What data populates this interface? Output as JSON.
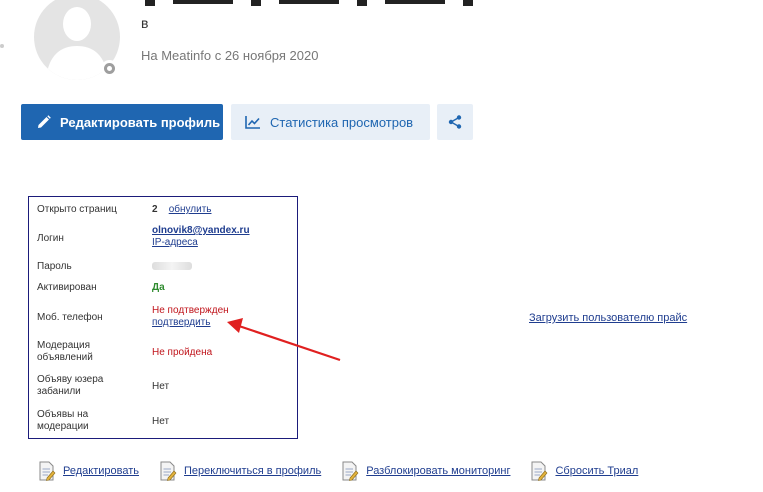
{
  "profile": {
    "letter": "в",
    "since": "На Meatinfo с 26 ноября 2020"
  },
  "buttons": {
    "edit_label": "Редактировать профиль",
    "stats_label": "Статистика просмотров"
  },
  "info": {
    "opened_pages_label": "Открыто страниц",
    "opened_pages_value": "2",
    "reset_link": "обнулить",
    "login_label": "Логин",
    "login_value": "olnovik8@yandex.ru",
    "ip_link": "IP-адреса",
    "password_label": "Пароль",
    "activated_label": "Активирован",
    "activated_value": "Да",
    "phone_label": "Моб. телефон",
    "phone_status": "Не подтвержден",
    "confirm_link": "подтвердить",
    "moderation_label_1": "Модерация",
    "moderation_label_2": "объявлений",
    "moderation_value": "Не пройдена",
    "banned_label_1": "Объяву юзера",
    "banned_label_2": "забанили",
    "banned_value": "Нет",
    "on_moderation_label_1": "Объявы на",
    "on_moderation_label_2": "модерации",
    "on_moderation_value": "Нет"
  },
  "upload_link": "Загрузить пользователю прайс",
  "actions": [
    {
      "label": "Редактировать",
      "icon": "document-edit-icon"
    },
    {
      "label": "Переключиться в профиль",
      "icon": "document-edit-icon"
    },
    {
      "label": "Разблокировать мониторинг",
      "icon": "document-edit-icon"
    },
    {
      "label": "Сбросить Триал",
      "icon": "document-edit-icon"
    }
  ],
  "colors": {
    "primary": "#1f66b1",
    "secondary_bg": "#e8eff7",
    "annotation_arrow": "#e02020",
    "red_text": "#c0141b",
    "green_text": "#2e8b2e"
  }
}
